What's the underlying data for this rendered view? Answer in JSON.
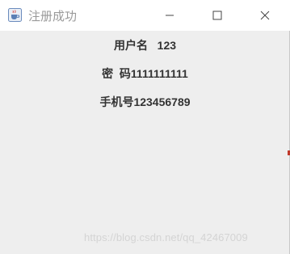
{
  "window": {
    "title": "注册成功",
    "icon": "java-coffee-cup-icon"
  },
  "titlebar_buttons": {
    "minimize_icon": "minimize-icon",
    "maximize_icon": "maximize-icon",
    "close_icon": "close-icon"
  },
  "fields": {
    "username_line": "用户名   123",
    "password_line": "密  码1111111111",
    "phone_line": "手机号123456789"
  },
  "watermark": "https://blog.csdn.net/qq_42467009",
  "colors": {
    "window_bg": "#eeeeee",
    "titlebar_bg": "#ffffff",
    "title_text": "#9a9a9a",
    "content_text": "#333333"
  }
}
